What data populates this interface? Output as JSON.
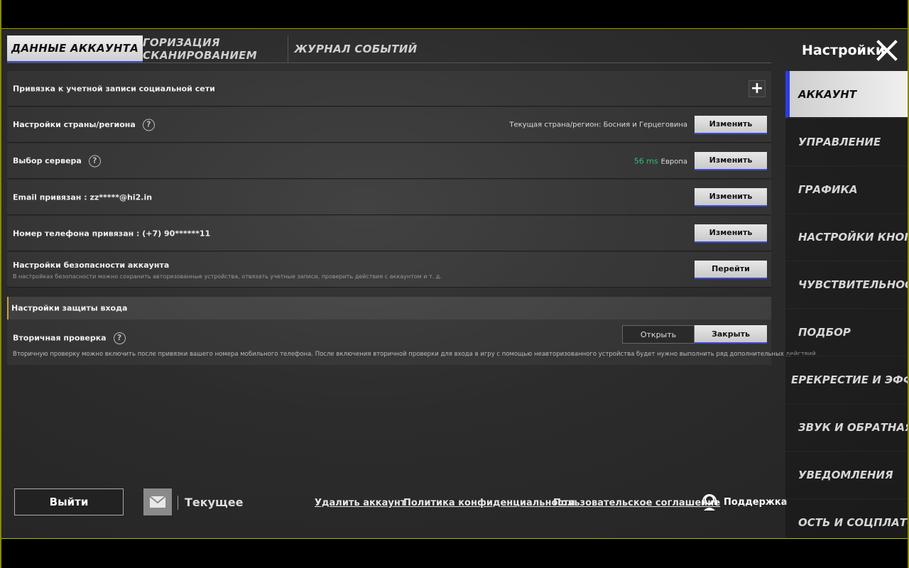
{
  "tabs": [
    {
      "label": "ДАННЫЕ АККАУНТА"
    },
    {
      "label": "ГОРИЗАЦИЯ СКАНИРОВАНИЕМ"
    },
    {
      "label": "ЖУРНАЛ СОБЫТИЙ"
    }
  ],
  "header": {
    "title": "Настройки"
  },
  "rows": {
    "social": {
      "label": "Привязка к учетной записи социальной сети"
    },
    "region": {
      "label": "Настройки страны/региона",
      "info": "Текущая страна/регион: Босния и Герцеговина",
      "button": "Изменить"
    },
    "server": {
      "label": "Выбор сервера",
      "ping": "56 ms",
      "server_name": "Европа",
      "button": "Изменить"
    },
    "email": {
      "label": "Email привязан : zz*****@hi2.in",
      "button": "Изменить"
    },
    "phone": {
      "label": "Номер телефона привязан : (+7) 90******11",
      "button": "Изменить"
    },
    "security": {
      "label": "Настройки безопасности аккаунта",
      "description": "В настройках безопасности можно сохранить авторизованные устройства, отвязать учетные записи, проверить действия с аккаунтом и т. д.",
      "button": "Перейти"
    }
  },
  "login_protection": {
    "heading": "Настройки защиты входа",
    "secondary_check": {
      "label": "Вторичная проверка",
      "option_open": "Открыть",
      "option_close": "Закрыть",
      "selected": "Закрыть",
      "description": "Вторичную проверку можно включить после привязки вашего номера мобильного телефона. После включения вторичной проверки для входа в игру с помощью неавторизованного устройства будет нужно выполнить ряд дополнительных действий."
    }
  },
  "footer": {
    "logout": "Выйти",
    "current": "Текущее",
    "links": {
      "delete": "Удалить аккаунт",
      "privacy": "Политика конфиденциальности",
      "agreement": "Пользовательское соглашение",
      "support": "Поддержка"
    }
  },
  "sidebar": {
    "items": [
      {
        "label": "АККАУНТ"
      },
      {
        "label": "УПРАВЛЕНИЕ"
      },
      {
        "label": "ГРАФИКА"
      },
      {
        "label": "НАСТРОЙКИ КНОПОК"
      },
      {
        "label": "ЧУВСТВИТЕЛЬНОСТЬ"
      },
      {
        "label": "ПОДБОР"
      },
      {
        "label": "ЕРЕКРЕСТИЕ И ЭФФЕКТ"
      },
      {
        "label": "ЗВУК И ОБРАТНАЯ СВЯ"
      },
      {
        "label": "УВЕДОМЛЕНИЯ"
      },
      {
        "label": "ОСТЬ И СОЦПЛАТФОРМ"
      }
    ]
  },
  "colors": {
    "accent": "#3d4ad6",
    "ping": "#2fbf71",
    "section_marker": "#c9a23a"
  }
}
